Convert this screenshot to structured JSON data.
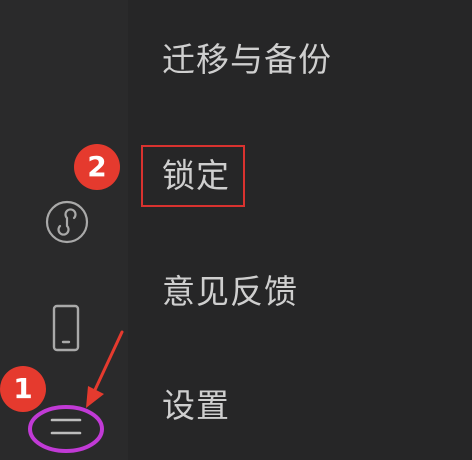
{
  "menu": {
    "items": [
      {
        "label": "迁移与备份"
      },
      {
        "label": "锁定"
      },
      {
        "label": "意见反馈"
      },
      {
        "label": "设置"
      }
    ]
  },
  "annotations": {
    "badge_1": "1",
    "badge_2": "2",
    "badge_color": "#e53a2e",
    "highlight_box_color": "#d9322f",
    "menu_icon_ellipse_color": "#c13ad6",
    "arrow_color": "#e53a2e"
  },
  "sidebar": {
    "icons": [
      "mini-program-icon",
      "phone-icon",
      "hamburger-menu-icon"
    ]
  },
  "theme": {
    "background": "#252526",
    "text_color": "#cfcfcf"
  }
}
